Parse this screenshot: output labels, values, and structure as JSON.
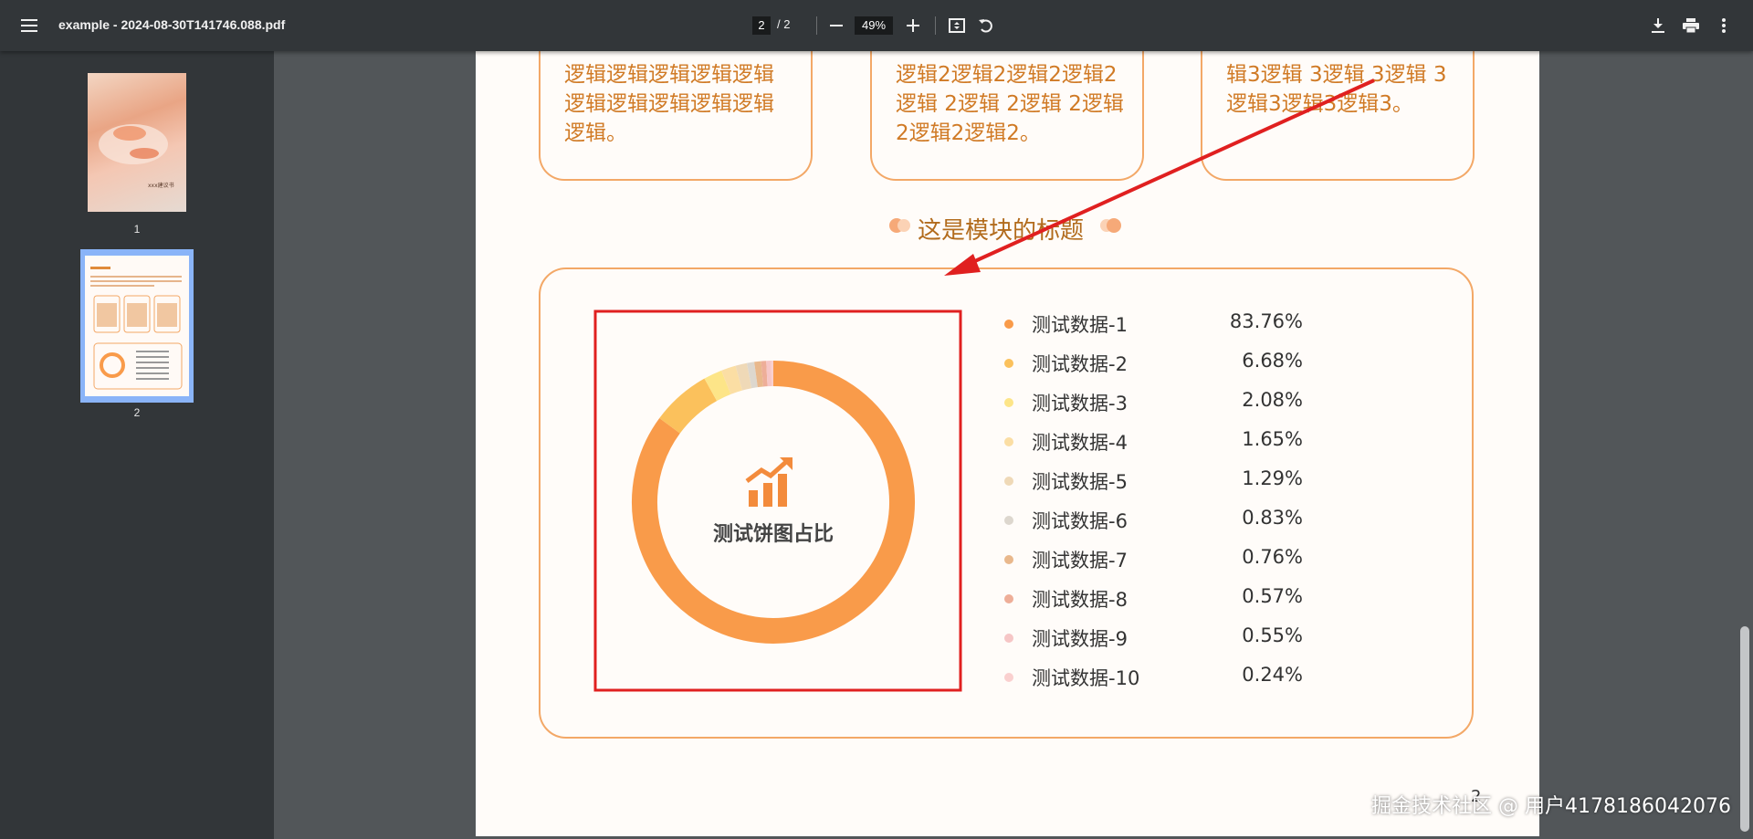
{
  "toolbar": {
    "title": "example - 2024-08-30T141746.088.pdf",
    "page_current": "2",
    "page_total": "/  2",
    "zoom": "49%"
  },
  "sidebar": {
    "thumbnails": [
      {
        "label": "1",
        "caption": "xxx建议书"
      },
      {
        "label": "2"
      }
    ]
  },
  "page": {
    "cards": [
      "逻辑逻辑逻辑逻辑逻辑逻辑逻辑逻辑逻辑逻辑逻辑。",
      "逻辑2逻辑2逻辑2逻辑2逻辑 2逻辑 2逻辑 2逻辑2逻辑2逻辑2。",
      "辑3逻辑 3逻辑 3逻辑 3逻辑3逻辑3逻辑3。"
    ],
    "section_title": "这是模块的标题",
    "chart_center_label": "测试饼图占比"
  },
  "chart_data": {
    "type": "pie",
    "categories": [
      "测试数据-1",
      "测试数据-2",
      "测试数据-3",
      "测试数据-4",
      "测试数据-5",
      "测试数据-6",
      "测试数据-7",
      "测试数据-8",
      "测试数据-9",
      "测试数据-10"
    ],
    "values": [
      83.76,
      6.68,
      2.08,
      1.65,
      1.29,
      0.83,
      0.76,
      0.57,
      0.55,
      0.24
    ],
    "value_labels": [
      "83.76%",
      "6.68%",
      "2.08%",
      "1.65%",
      "1.29%",
      "0.83%",
      "0.76%",
      "0.57%",
      "0.55%",
      "0.24%"
    ],
    "colors": [
      "#f99b4a",
      "#fbc15c",
      "#fde588",
      "#fbdea4",
      "#efd9b7",
      "#ddd7ce",
      "#e9b88c",
      "#eeae98",
      "#f6c6c6",
      "#fad0cf"
    ],
    "donut": true,
    "legend_position": "right"
  },
  "annotation_colors": {
    "highlight_box": "#e02020",
    "arrow": "#e02020"
  },
  "watermark": "掘金技术社区 @ 用户4178186042076"
}
